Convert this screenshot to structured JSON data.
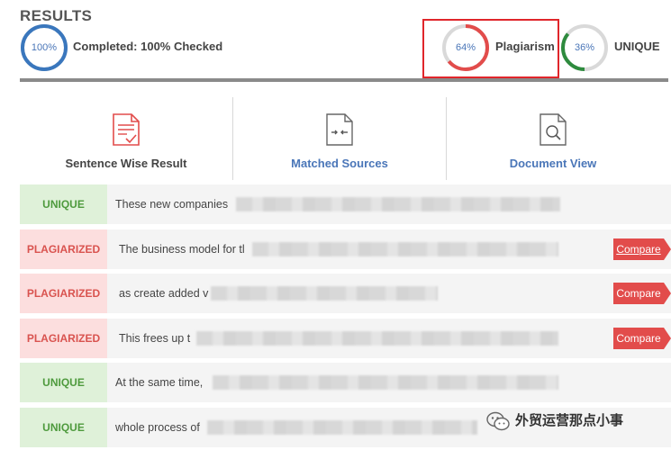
{
  "results": {
    "title": "RESULTS",
    "completed": {
      "percent_label": "100%",
      "value": 1.0,
      "label": "Completed: 100% Checked",
      "color": "#3a77bd"
    },
    "plagiarism": {
      "percent_label": "64%",
      "value": 0.64,
      "label": "Plagiarism",
      "color": "#e24c4b"
    },
    "unique": {
      "percent_label": "36%",
      "value": 0.36,
      "label": "UNIQUE",
      "color": "#2e8b3e"
    }
  },
  "tools": [
    {
      "label": "Sentence Wise Result",
      "icon": "document-check-icon"
    },
    {
      "label": "Matched Sources",
      "icon": "document-arrows-icon"
    },
    {
      "label": "Document View",
      "icon": "document-search-icon"
    }
  ],
  "rows": [
    {
      "status": "UNIQUE",
      "type": "unique",
      "text": "These new companies",
      "compare": ""
    },
    {
      "status": "PLAGIARIZED",
      "type": "plag",
      "text": "The business model for tl",
      "compare": "Compare"
    },
    {
      "status": "PLAGIARIZED",
      "type": "plag",
      "text": "as create added v",
      "compare": "Compare"
    },
    {
      "status": "PLAGIARIZED",
      "type": "plag",
      "text": "This frees up t",
      "compare": "Compare"
    },
    {
      "status": "UNIQUE",
      "type": "unique",
      "text": "At the same time,",
      "compare": ""
    },
    {
      "status": "UNIQUE",
      "type": "unique",
      "text": "whole process of",
      "compare": ""
    }
  ],
  "watermark": {
    "text": "外贸运营那点小事",
    "icon": "wechat-icon"
  }
}
